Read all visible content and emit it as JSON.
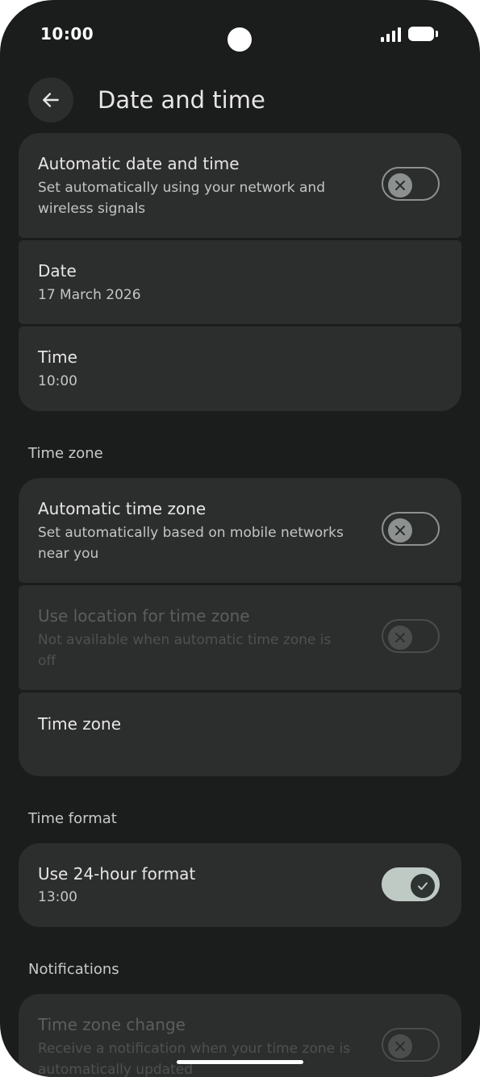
{
  "status_bar": {
    "time": "10:00"
  },
  "header": {
    "title": "Date and time"
  },
  "auto_date_time": {
    "title": "Automatic date and time",
    "summary": "Set automatically using your network and wireless signals",
    "enabled": false
  },
  "date": {
    "title": "Date",
    "value": "17 March 2026"
  },
  "time": {
    "title": "Time",
    "value": "10:00"
  },
  "sections": {
    "time_zone": "Time zone",
    "time_format": "Time format",
    "notifications": "Notifications"
  },
  "auto_time_zone": {
    "title": "Automatic time zone",
    "summary": "Set automatically based on mobile networks near you",
    "enabled": false
  },
  "location_time_zone": {
    "title": "Use location for time zone",
    "summary": "Not available when automatic time zone is off",
    "enabled": false,
    "available": false
  },
  "time_zone_item": {
    "title": "Time zone"
  },
  "hour_format": {
    "title": "Use 24-hour format",
    "example": "13:00",
    "enabled": true
  },
  "time_zone_change": {
    "title": "Time zone change",
    "summary": "Receive a notification when your time zone is automatically updated",
    "enabled": false,
    "available": false
  },
  "colors": {
    "background": "#1b1c1c",
    "card": "#2c2d2d",
    "switch_on_track": "#bfcac5"
  }
}
